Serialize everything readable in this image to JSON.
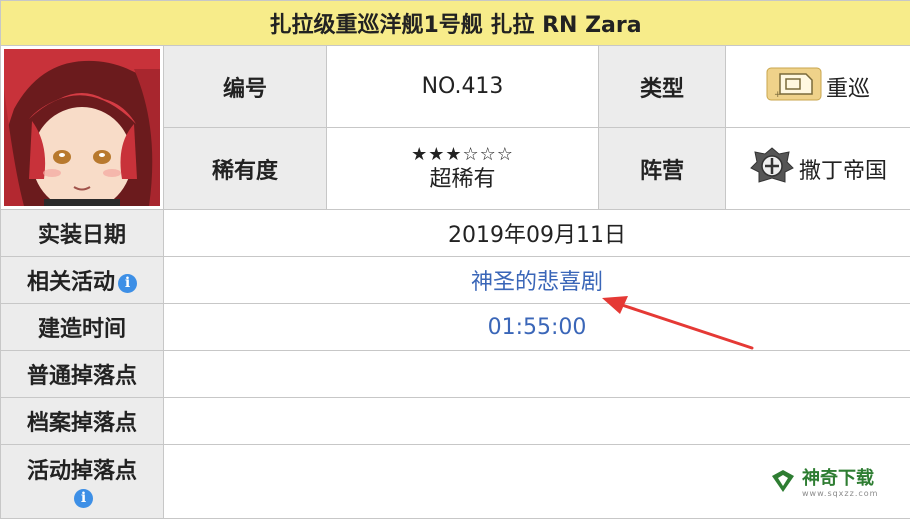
{
  "title": "扎拉级重巡洋舰1号舰 扎拉 RN Zara",
  "rows": {
    "number": {
      "label": "编号",
      "value": "NO.413"
    },
    "type": {
      "label": "类型",
      "value": "重巡",
      "icon": "heavy-cruiser-icon"
    },
    "rarity": {
      "label": "稀有度",
      "stars": "★★★☆☆☆",
      "value": "超稀有"
    },
    "faction": {
      "label": "阵营",
      "value": "撒丁帝国",
      "icon": "sardegna-empire-emblem-icon"
    },
    "release_date": {
      "label": "实装日期",
      "value": "2019年09月11日"
    },
    "related_event": {
      "label": "相关活动",
      "value": "神圣的悲喜剧"
    },
    "build_time": {
      "label": "建造时间",
      "value": "01:55:00"
    },
    "normal_drop": {
      "label": "普通掉落点",
      "value": ""
    },
    "archive_drop": {
      "label": "档案掉落点",
      "value": ""
    },
    "event_drop": {
      "label": "活动掉落点",
      "value": ""
    }
  },
  "info_icon_glyph": "i",
  "watermark": {
    "text": "神奇下载",
    "url": "www.sqxzz.com"
  },
  "colors": {
    "title_bg": "#f7ec8a",
    "header_bg": "#ececec",
    "link": "#3a66b8",
    "arrow": "#e53935",
    "info_icon": "#3d8fe6"
  }
}
